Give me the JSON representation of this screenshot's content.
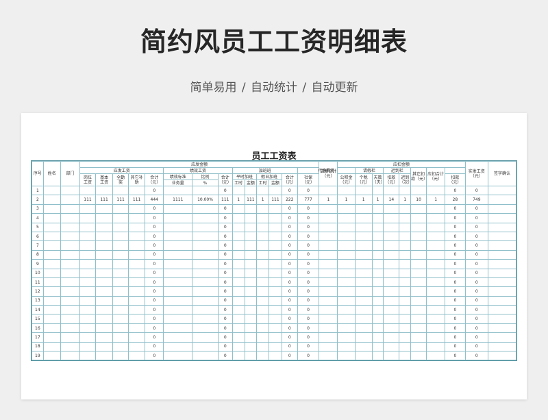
{
  "page": {
    "title": "简约风员工工资明细表",
    "subtitle": "简单易用  /  自动统计  /  自动更新"
  },
  "sheet": {
    "title": "员工工资表",
    "headers": {
      "seq": "序号",
      "name": "姓名",
      "dept": "部门",
      "payable_group": "应发金额",
      "payable_wage": "应发工资",
      "post_wage": "岗位\n工资",
      "basic_wage": "基本\n工资",
      "attendance": "全勤\n奖",
      "other_subsidy": "其它补\n助",
      "wage_total": "合计\n（元）",
      "perf_wage": "绩效工资",
      "perf_standard": "绩效标准",
      "perf_ratio": "比例",
      "task_amount": "业务量",
      "percent": "%",
      "perf_total": "合计\n（元）",
      "overtime": "加班班",
      "weekday_ot": "平时加班",
      "holiday_ot": "假日加班",
      "hours": "工时",
      "amount": "金额",
      "ot_total": "合计\n（元）",
      "payable_total": "应发合计\n（元）",
      "deduct_group": "应扣金额",
      "withhold": "代缴费用",
      "social": "社保\n（元）",
      "fund": "公积金\n（元）",
      "tax": "个税\n（元）",
      "leave": "请假栏",
      "days": "天数\n（天）",
      "leave_deduct": "扣款\n（元）",
      "late": "迟到栏",
      "late_count": "迟到\n（次）",
      "late_deduct": "扣款\n（元）",
      "other_deduct": "其它扣\n款（元）",
      "deduct_total": "应扣合计\n（元）",
      "net_pay": "实发工资\n（元）",
      "sign": "签字确认"
    },
    "rows": [
      {
        "seq": "1",
        "post": "",
        "basic": "",
        "full": "",
        "other": "",
        "wt": "0",
        "std": "",
        "ratio": "",
        "pt": "0",
        "wh": "",
        "wa": "",
        "hh": "",
        "ha": "",
        "ot": "0",
        "pay": "0",
        "soc": "",
        "fund": "",
        "tax": "",
        "days": "",
        "ld": "",
        "lc": "",
        "lde": "",
        "od": "",
        "dt": "0",
        "net": "0"
      },
      {
        "seq": "2",
        "post": "111",
        "basic": "111",
        "full": "111",
        "other": "111",
        "wt": "444",
        "std": "1111",
        "ratio": "10.00%",
        "pt": "111",
        "wh": "1",
        "wa": "111",
        "hh": "1",
        "ha": "111",
        "ot": "222",
        "pay": "777",
        "soc": "1",
        "fund": "1",
        "tax": "1",
        "days": "1",
        "ld": "14",
        "lc": "1",
        "lde": "10",
        "od": "1",
        "dt": "28",
        "net": "749"
      },
      {
        "seq": "3",
        "post": "",
        "basic": "",
        "full": "",
        "other": "",
        "wt": "0",
        "std": "",
        "ratio": "",
        "pt": "0",
        "wh": "",
        "wa": "",
        "hh": "",
        "ha": "",
        "ot": "0",
        "pay": "0",
        "soc": "",
        "fund": "",
        "tax": "",
        "days": "",
        "ld": "",
        "lc": "",
        "lde": "",
        "od": "",
        "dt": "0",
        "net": "0"
      },
      {
        "seq": "4",
        "post": "",
        "basic": "",
        "full": "",
        "other": "",
        "wt": "0",
        "std": "",
        "ratio": "",
        "pt": "0",
        "wh": "",
        "wa": "",
        "hh": "",
        "ha": "",
        "ot": "0",
        "pay": "0",
        "soc": "",
        "fund": "",
        "tax": "",
        "days": "",
        "ld": "",
        "lc": "",
        "lde": "",
        "od": "",
        "dt": "0",
        "net": "0"
      },
      {
        "seq": "5",
        "post": "",
        "basic": "",
        "full": "",
        "other": "",
        "wt": "0",
        "std": "",
        "ratio": "",
        "pt": "0",
        "wh": "",
        "wa": "",
        "hh": "",
        "ha": "",
        "ot": "0",
        "pay": "0",
        "soc": "",
        "fund": "",
        "tax": "",
        "days": "",
        "ld": "",
        "lc": "",
        "lde": "",
        "od": "",
        "dt": "0",
        "net": "0"
      },
      {
        "seq": "6",
        "post": "",
        "basic": "",
        "full": "",
        "other": "",
        "wt": "0",
        "std": "",
        "ratio": "",
        "pt": "0",
        "wh": "",
        "wa": "",
        "hh": "",
        "ha": "",
        "ot": "0",
        "pay": "0",
        "soc": "",
        "fund": "",
        "tax": "",
        "days": "",
        "ld": "",
        "lc": "",
        "lde": "",
        "od": "",
        "dt": "0",
        "net": "0"
      },
      {
        "seq": "7",
        "post": "",
        "basic": "",
        "full": "",
        "other": "",
        "wt": "0",
        "std": "",
        "ratio": "",
        "pt": "0",
        "wh": "",
        "wa": "",
        "hh": "",
        "ha": "",
        "ot": "0",
        "pay": "0",
        "soc": "",
        "fund": "",
        "tax": "",
        "days": "",
        "ld": "",
        "lc": "",
        "lde": "",
        "od": "",
        "dt": "0",
        "net": "0"
      },
      {
        "seq": "8",
        "post": "",
        "basic": "",
        "full": "",
        "other": "",
        "wt": "0",
        "std": "",
        "ratio": "",
        "pt": "0",
        "wh": "",
        "wa": "",
        "hh": "",
        "ha": "",
        "ot": "0",
        "pay": "0",
        "soc": "",
        "fund": "",
        "tax": "",
        "days": "",
        "ld": "",
        "lc": "",
        "lde": "",
        "od": "",
        "dt": "0",
        "net": "0"
      },
      {
        "seq": "9",
        "post": "",
        "basic": "",
        "full": "",
        "other": "",
        "wt": "0",
        "std": "",
        "ratio": "",
        "pt": "0",
        "wh": "",
        "wa": "",
        "hh": "",
        "ha": "",
        "ot": "0",
        "pay": "0",
        "soc": "",
        "fund": "",
        "tax": "",
        "days": "",
        "ld": "",
        "lc": "",
        "lde": "",
        "od": "",
        "dt": "0",
        "net": "0"
      },
      {
        "seq": "10",
        "post": "",
        "basic": "",
        "full": "",
        "other": "",
        "wt": "0",
        "std": "",
        "ratio": "",
        "pt": "0",
        "wh": "",
        "wa": "",
        "hh": "",
        "ha": "",
        "ot": "0",
        "pay": "0",
        "soc": "",
        "fund": "",
        "tax": "",
        "days": "",
        "ld": "",
        "lc": "",
        "lde": "",
        "od": "",
        "dt": "0",
        "net": "0"
      },
      {
        "seq": "11",
        "post": "",
        "basic": "",
        "full": "",
        "other": "",
        "wt": "0",
        "std": "",
        "ratio": "",
        "pt": "0",
        "wh": "",
        "wa": "",
        "hh": "",
        "ha": "",
        "ot": "0",
        "pay": "0",
        "soc": "",
        "fund": "",
        "tax": "",
        "days": "",
        "ld": "",
        "lc": "",
        "lde": "",
        "od": "",
        "dt": "0",
        "net": "0"
      },
      {
        "seq": "12",
        "post": "",
        "basic": "",
        "full": "",
        "other": "",
        "wt": "0",
        "std": "",
        "ratio": "",
        "pt": "0",
        "wh": "",
        "wa": "",
        "hh": "",
        "ha": "",
        "ot": "0",
        "pay": "0",
        "soc": "",
        "fund": "",
        "tax": "",
        "days": "",
        "ld": "",
        "lc": "",
        "lde": "",
        "od": "",
        "dt": "0",
        "net": "0"
      },
      {
        "seq": "13",
        "post": "",
        "basic": "",
        "full": "",
        "other": "",
        "wt": "0",
        "std": "",
        "ratio": "",
        "pt": "0",
        "wh": "",
        "wa": "",
        "hh": "",
        "ha": "",
        "ot": "0",
        "pay": "0",
        "soc": "",
        "fund": "",
        "tax": "",
        "days": "",
        "ld": "",
        "lc": "",
        "lde": "",
        "od": "",
        "dt": "0",
        "net": "0"
      },
      {
        "seq": "14",
        "post": "",
        "basic": "",
        "full": "",
        "other": "",
        "wt": "0",
        "std": "",
        "ratio": "",
        "pt": "0",
        "wh": "",
        "wa": "",
        "hh": "",
        "ha": "",
        "ot": "0",
        "pay": "0",
        "soc": "",
        "fund": "",
        "tax": "",
        "days": "",
        "ld": "",
        "lc": "",
        "lde": "",
        "od": "",
        "dt": "0",
        "net": "0"
      },
      {
        "seq": "15",
        "post": "",
        "basic": "",
        "full": "",
        "other": "",
        "wt": "0",
        "std": "",
        "ratio": "",
        "pt": "0",
        "wh": "",
        "wa": "",
        "hh": "",
        "ha": "",
        "ot": "0",
        "pay": "0",
        "soc": "",
        "fund": "",
        "tax": "",
        "days": "",
        "ld": "",
        "lc": "",
        "lde": "",
        "od": "",
        "dt": "0",
        "net": "0"
      },
      {
        "seq": "16",
        "post": "",
        "basic": "",
        "full": "",
        "other": "",
        "wt": "0",
        "std": "",
        "ratio": "",
        "pt": "0",
        "wh": "",
        "wa": "",
        "hh": "",
        "ha": "",
        "ot": "0",
        "pay": "0",
        "soc": "",
        "fund": "",
        "tax": "",
        "days": "",
        "ld": "",
        "lc": "",
        "lde": "",
        "od": "",
        "dt": "0",
        "net": "0"
      },
      {
        "seq": "17",
        "post": "",
        "basic": "",
        "full": "",
        "other": "",
        "wt": "0",
        "std": "",
        "ratio": "",
        "pt": "0",
        "wh": "",
        "wa": "",
        "hh": "",
        "ha": "",
        "ot": "0",
        "pay": "0",
        "soc": "",
        "fund": "",
        "tax": "",
        "days": "",
        "ld": "",
        "lc": "",
        "lde": "",
        "od": "",
        "dt": "0",
        "net": "0"
      },
      {
        "seq": "18",
        "post": "",
        "basic": "",
        "full": "",
        "other": "",
        "wt": "0",
        "std": "",
        "ratio": "",
        "pt": "0",
        "wh": "",
        "wa": "",
        "hh": "",
        "ha": "",
        "ot": "0",
        "pay": "0",
        "soc": "",
        "fund": "",
        "tax": "",
        "days": "",
        "ld": "",
        "lc": "",
        "lde": "",
        "od": "",
        "dt": "0",
        "net": "0"
      },
      {
        "seq": "19",
        "post": "",
        "basic": "",
        "full": "",
        "other": "",
        "wt": "0",
        "std": "",
        "ratio": "",
        "pt": "0",
        "wh": "",
        "wa": "",
        "hh": "",
        "ha": "",
        "ot": "0",
        "pay": "0",
        "soc": "",
        "fund": "",
        "tax": "",
        "days": "",
        "ld": "",
        "lc": "",
        "lde": "",
        "od": "",
        "dt": "0",
        "net": "0"
      }
    ]
  }
}
